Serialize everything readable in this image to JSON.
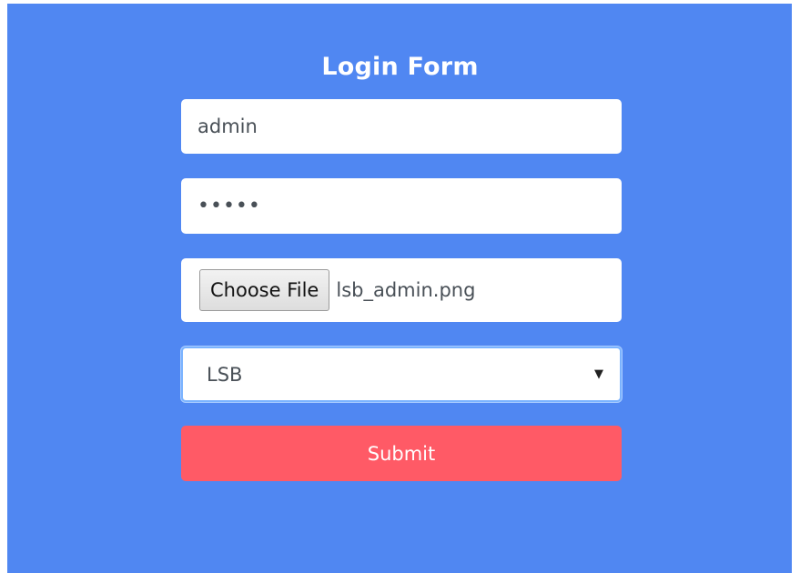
{
  "form": {
    "title": "Login Form",
    "username_value": "admin",
    "password_value": "•••••",
    "file_button_label": "Choose File",
    "file_name": "lsb_admin.png",
    "method_selected": "LSB",
    "submit_label": "Submit"
  },
  "icons": {
    "select_caret": "chevron-down-icon"
  },
  "colors": {
    "background": "#5087f2",
    "submit": "#ff5a66",
    "field": "#ffffff",
    "focus_outline": "#7ab3ff"
  }
}
